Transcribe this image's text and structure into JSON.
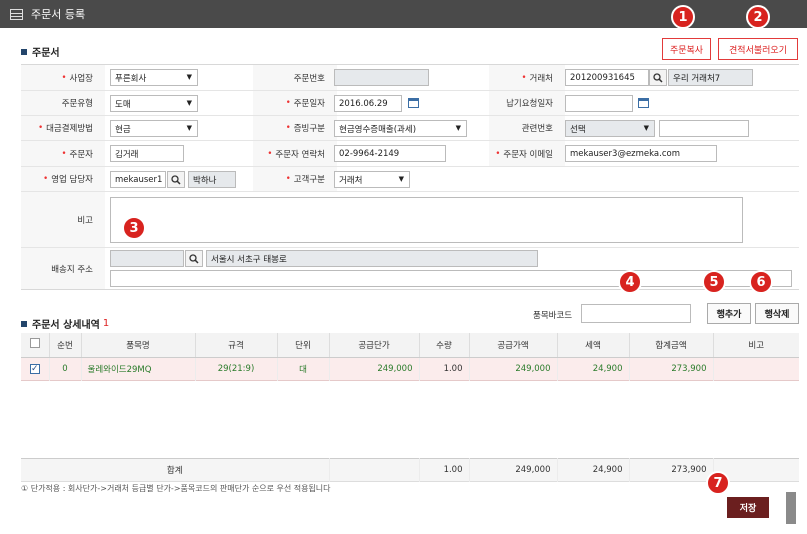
{
  "window": {
    "title": "주문서 등록"
  },
  "header_buttons": {
    "copy": "주문복사",
    "load_quote": "견적서불러오기"
  },
  "badges": [
    "1",
    "2",
    "3",
    "4",
    "5",
    "6",
    "7"
  ],
  "order": {
    "section_title": "주문서",
    "fields": {
      "business": {
        "label": "사업장",
        "value": "푸른회사"
      },
      "order_no": {
        "label": "주문번호",
        "value": ""
      },
      "customer": {
        "label": "거래처",
        "code": "201200931645",
        "name": "우리 거래처7"
      },
      "order_type": {
        "label": "주문유형",
        "value": "도매"
      },
      "order_date": {
        "label": "주문일자",
        "value": "2016.06.29"
      },
      "delivery_date": {
        "label": "납기요청일자",
        "value": ""
      },
      "payment": {
        "label": "대금결제방법",
        "value": "현금"
      },
      "evidence": {
        "label": "증빙구분",
        "value": "현금영수증매출(과세)"
      },
      "related_no": {
        "label": "관련번호",
        "select": "선택",
        "value": ""
      },
      "orderer": {
        "label": "주문자",
        "value": "김거래"
      },
      "orderer_phone": {
        "label": "주문자 연락처",
        "value": "02-9964-2149"
      },
      "orderer_email": {
        "label": "주문자 이메일",
        "value": "mekauser3@ezmeka.com"
      },
      "sales_rep": {
        "label": "영업 담당자",
        "id": "mekauser1",
        "name": "박하나"
      },
      "customer_type": {
        "label": "고객구분",
        "value": "거래처"
      },
      "memo": {
        "label": "비고",
        "value": ""
      },
      "address": {
        "label": "배송지 주소",
        "zip": "",
        "addr1": "서울시 서초구 태봉로",
        "addr2": ""
      }
    }
  },
  "detail": {
    "section_title": "주문서 상세내역",
    "count": "1",
    "barcode_label": "품목바코드",
    "barcode_value": "",
    "add_row": "행추가",
    "delete_row": "행삭제",
    "columns": [
      "순번",
      "품목명",
      "규격",
      "단위",
      "공급단가",
      "수량",
      "공급가액",
      "세액",
      "합계금액",
      "비고"
    ],
    "rows": [
      {
        "seq": "0",
        "item": "울레와이드29MQ",
        "spec": "29(21:9)",
        "unit": "대",
        "price": "249,000",
        "qty": "1.00",
        "supply": "249,000",
        "tax": "24,900",
        "total": "273,900",
        "memo": ""
      }
    ],
    "footer": {
      "label": "합계",
      "qty": "1.00",
      "supply": "249,000",
      "tax": "24,900",
      "total": "273,900"
    },
    "note": "① 단가적용 : 회사단가->거래처 등급별 단가->품목코드의 판매단가 순으로 우선 적용됩니다"
  },
  "save_button": "저장",
  "colors": {
    "titlebar": "#4a4a4a",
    "accent_red": "#d8231f",
    "save": "#6b1f1f",
    "selected_row": "#fbecec"
  }
}
